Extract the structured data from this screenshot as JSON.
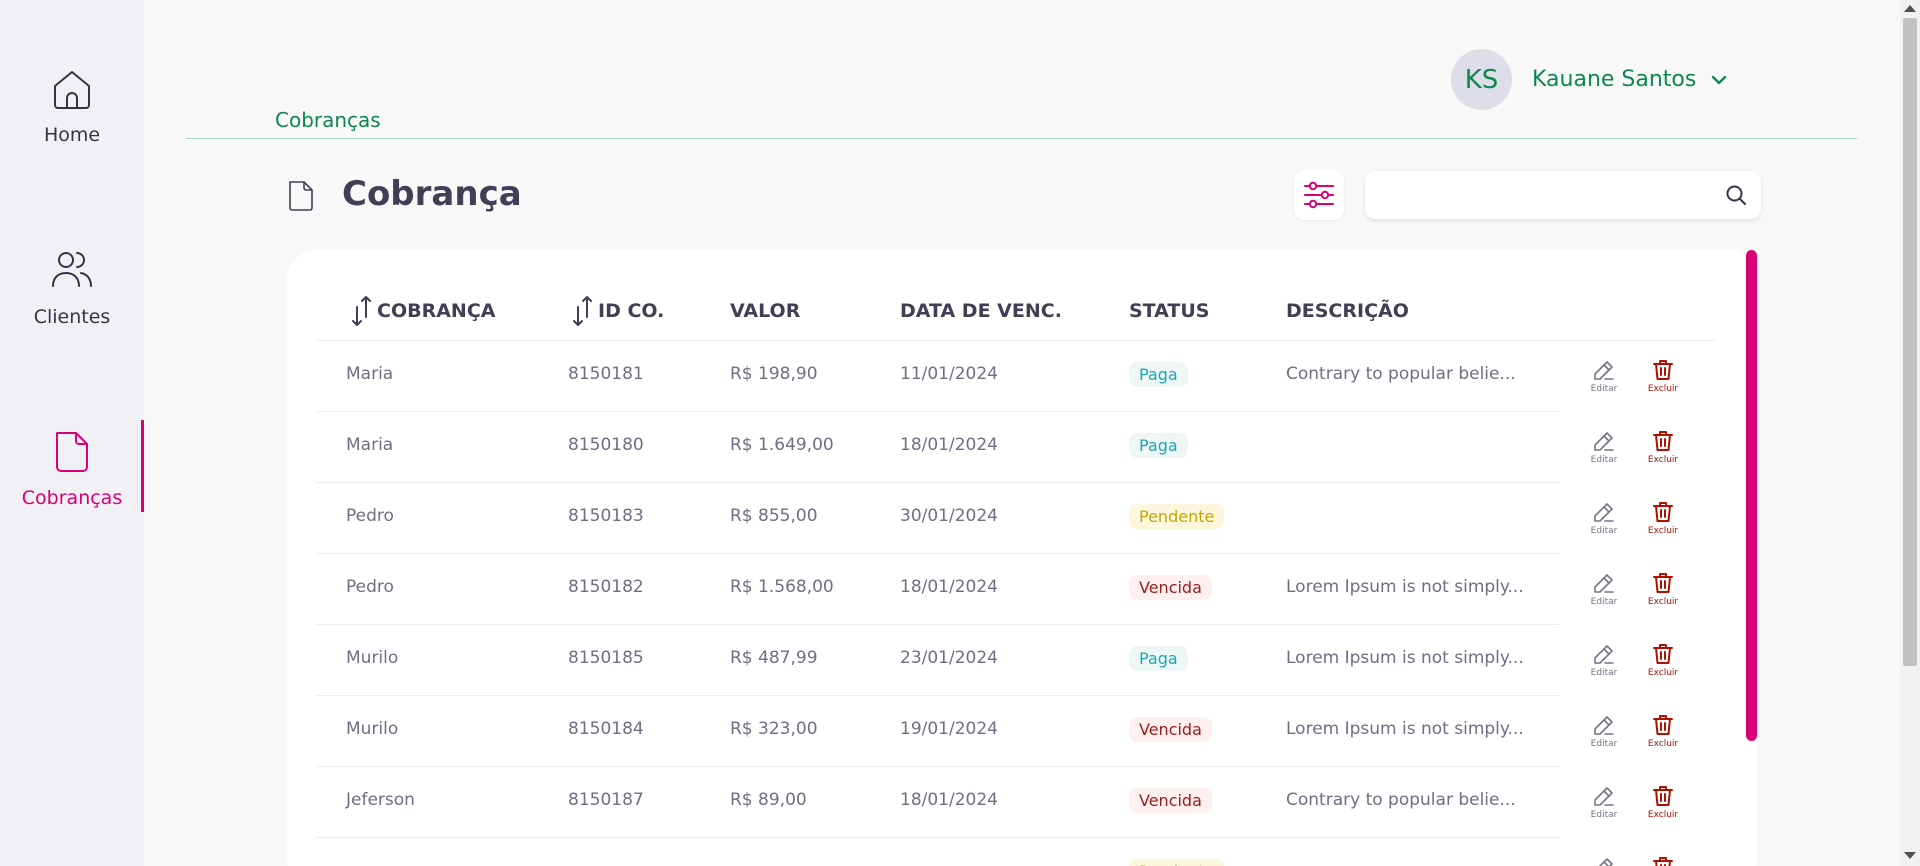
{
  "sidebar": {
    "items": [
      {
        "label": "Home",
        "icon": "home-icon"
      },
      {
        "label": "Clientes",
        "icon": "users-icon"
      },
      {
        "label": "Cobranças",
        "icon": "document-icon",
        "active": true
      }
    ]
  },
  "header": {
    "avatar_initials": "KS",
    "user_name": "Kauane Santos",
    "breadcrumb": "Cobranças"
  },
  "page": {
    "title": "Cobrança",
    "search_placeholder": ""
  },
  "table": {
    "columns": [
      "COBRANÇA",
      "ID CO.",
      "VALOR",
      "DATA DE VENC.",
      "STATUS",
      "DESCRIÇÃO"
    ],
    "edit_label": "Editar",
    "delete_label": "Excluir",
    "rows": [
      {
        "cliente": "Maria",
        "id": "8150181",
        "valor": "R$ 198,90",
        "vencimento": "11/01/2024",
        "status": "Paga",
        "descricao": "Contrary to popular belie..."
      },
      {
        "cliente": "Maria",
        "id": "8150180",
        "valor": "R$ 1.649,00",
        "vencimento": "18/01/2024",
        "status": "Paga",
        "descricao": ""
      },
      {
        "cliente": "Pedro",
        "id": "8150183",
        "valor": "R$ 855,00",
        "vencimento": "30/01/2024",
        "status": "Pendente",
        "descricao": ""
      },
      {
        "cliente": "Pedro",
        "id": "8150182",
        "valor": "R$ 1.568,00",
        "vencimento": "18/01/2024",
        "status": "Vencida",
        "descricao": "Lorem Ipsum is not simply..."
      },
      {
        "cliente": "Murilo",
        "id": "8150185",
        "valor": "R$ 487,99",
        "vencimento": "23/01/2024",
        "status": "Paga",
        "descricao": "Lorem Ipsum is not simply..."
      },
      {
        "cliente": "Murilo",
        "id": "8150184",
        "valor": "R$ 323,00",
        "vencimento": "19/01/2024",
        "status": "Vencida",
        "descricao": "Lorem Ipsum is not simply..."
      },
      {
        "cliente": "Jeferson",
        "id": "8150187",
        "valor": "R$ 89,00",
        "vencimento": "18/01/2024",
        "status": "Vencida",
        "descricao": "Contrary to popular belie..."
      },
      {
        "cliente": "",
        "id": "",
        "valor": "",
        "vencimento": "",
        "status": "Pendente",
        "descricao": ""
      }
    ]
  },
  "colors": {
    "accent": "#da0175",
    "brand_green": "#0e8750",
    "status_paga": "#1fa7af",
    "status_pendente": "#c5a605",
    "status_vencida": "#971d1d"
  }
}
